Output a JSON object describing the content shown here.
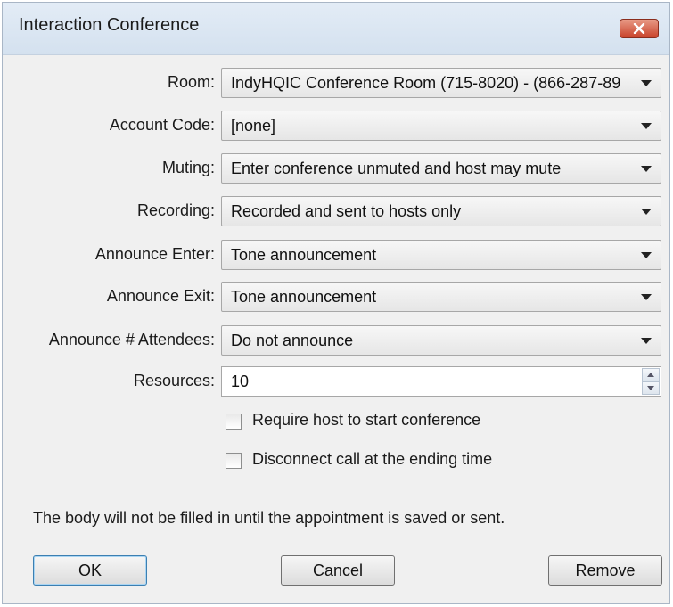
{
  "window": {
    "title": "Interaction Conference"
  },
  "form": {
    "room": {
      "label": "Room:",
      "value": "IndyHQIC Conference Room (715-8020) - (866-287-89"
    },
    "account_code": {
      "label": "Account Code:",
      "value": "[none]"
    },
    "muting": {
      "label": "Muting:",
      "value": "Enter conference unmuted and host may mute"
    },
    "recording": {
      "label": "Recording:",
      "value": "Recorded and sent to hosts only"
    },
    "announce_enter": {
      "label": "Announce Enter:",
      "value": "Tone announcement"
    },
    "announce_exit": {
      "label": "Announce Exit:",
      "value": "Tone announcement"
    },
    "announce_attendees": {
      "label": "Announce # Attendees:",
      "value": "Do not announce"
    },
    "resources": {
      "label": "Resources:",
      "value": "10"
    },
    "require_host": {
      "label": "Require host to start conference",
      "checked": false
    },
    "disconnect_call": {
      "label": "Disconnect call at the ending time",
      "checked": false
    }
  },
  "note": "The body will not be filled in until the appointment is saved or sent.",
  "buttons": {
    "ok": "OK",
    "cancel": "Cancel",
    "remove": "Remove"
  },
  "colors": {
    "close_button": "#c9432b",
    "titlebar": "#d4e1ef",
    "dialog_background": "#f0f0f0"
  }
}
